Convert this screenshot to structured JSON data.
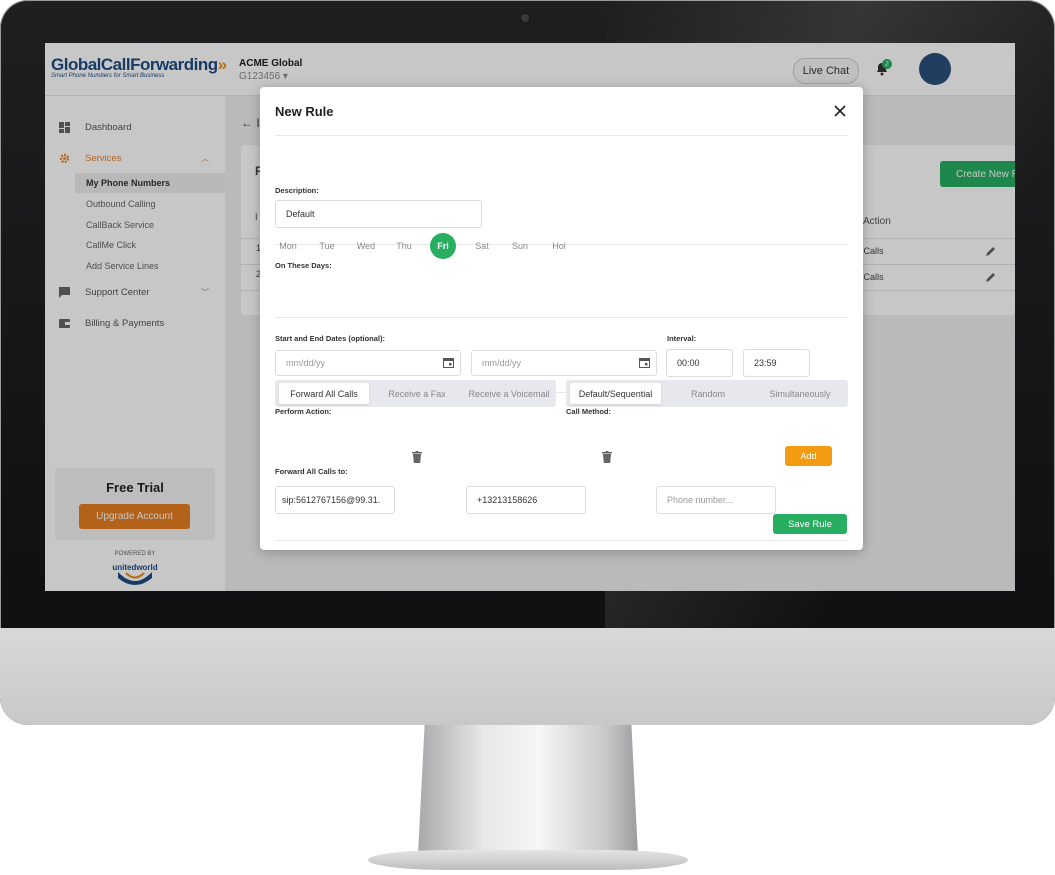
{
  "app": {
    "logo_text_a": "GlobalCall",
    "logo_text_b": "Forwarding",
    "logo_chevrons": "»",
    "logo_tagline": "Smart Phone Numbers for Smart Business",
    "account_name": "ACME Global",
    "account_id": "G123456 ▾",
    "live_chat": "Live Chat",
    "notification_count": "2",
    "brand_colors": {
      "blue": "#1e4c84",
      "orange": "#e67e22",
      "green": "#27ae60"
    }
  },
  "sidebar": {
    "items": [
      {
        "label": "Dashboard",
        "icon": "dashboard-icon"
      },
      {
        "label": "Services",
        "icon": "gear-icon",
        "expanded": true
      },
      {
        "label": "Support Center",
        "icon": "chat-icon"
      },
      {
        "label": "Billing & Payments",
        "icon": "wallet-icon"
      }
    ],
    "services_sub": [
      "My Phone Numbers",
      "Outbound Calling",
      "CallBack Service",
      "CallMe Click",
      "Add Service Lines"
    ],
    "selected_sub": "My Phone Numbers",
    "trial_title": "Free Trial",
    "trial_button": "Upgrade Account",
    "powered_by": "POWERED BY",
    "powered_brand": "unitedworld"
  },
  "background": {
    "create_button": "Create New R",
    "action_header": "Action",
    "row1_action": "ll Calls",
    "row2_action": "ll Calls",
    "edge_title": "F",
    "edge_header": "I",
    "edge_row1": "1",
    "edge_row2": "2",
    "back_label": "← I"
  },
  "modal": {
    "title": "New Rule",
    "description_label": "Description:",
    "description_value": "Default",
    "days_label": "On These Days:",
    "days": [
      "Mon",
      "Tue",
      "Wed",
      "Thu",
      "Fri",
      "Sat",
      "Sun",
      "Hol"
    ],
    "selected_day": "Fri",
    "dates_label": "Start and End Dates (optional):",
    "start_date_placeholder": "mm/dd/yy",
    "end_date_placeholder": "mm/dd/yy",
    "interval_label": "Interval:",
    "interval_start": "00:00",
    "interval_end": "23:59",
    "perform_action_label": "Perform Action:",
    "perform_actions": [
      "Forward All Calls",
      "Receive a Fax",
      "Receive a Voicemail"
    ],
    "selected_action": "Forward All Calls",
    "call_method_label": "Call Method:",
    "call_methods": [
      "Default/Sequential",
      "Random",
      "Simultaneously"
    ],
    "selected_method": "Default/Sequential",
    "forward_label": "Forward All Calls to:",
    "destinations": [
      "sip:5612767156@99.31.",
      "+13213158626"
    ],
    "new_destination_placeholder": "Phone number...",
    "add_button": "Add",
    "save_button": "Save Rule"
  }
}
